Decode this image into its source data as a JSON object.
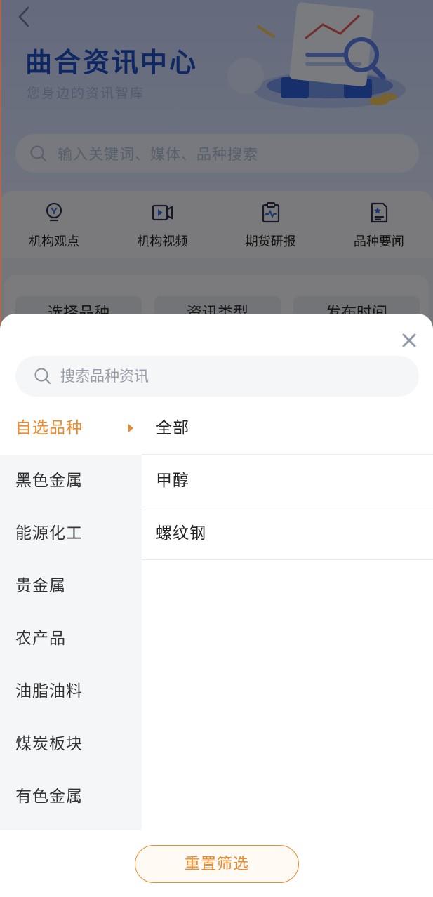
{
  "hero": {
    "title": "曲合资讯中心",
    "subtitle": "您身边的资讯智库"
  },
  "background_search": {
    "placeholder": "输入关键词、媒体、品种搜索"
  },
  "quick_links": [
    {
      "label": "机构观点",
      "icon": "bulb-icon"
    },
    {
      "label": "机构视频",
      "icon": "video-icon"
    },
    {
      "label": "期货研报",
      "icon": "report-icon"
    },
    {
      "label": "品种要闻",
      "icon": "news-icon"
    }
  ],
  "filters": [
    {
      "label": "选择品种"
    },
    {
      "label": "资讯类型"
    },
    {
      "label": "发布时间"
    }
  ],
  "sheet": {
    "search_placeholder": "搜索品种资讯",
    "categories": [
      {
        "label": "自选品种",
        "active": true
      },
      {
        "label": "黑色金属"
      },
      {
        "label": "能源化工"
      },
      {
        "label": "贵金属"
      },
      {
        "label": "农产品"
      },
      {
        "label": "油脂油料"
      },
      {
        "label": "煤炭板块"
      },
      {
        "label": "有色金属"
      }
    ],
    "options": [
      {
        "label": "全部"
      },
      {
        "label": "甲醇"
      },
      {
        "label": "螺纹钢"
      }
    ],
    "reset_label": "重置筛选"
  },
  "colors": {
    "accent": "#ef8a2c",
    "hero_title": "#1f4fc4",
    "sidebar_bg": "#f5f6f8"
  }
}
